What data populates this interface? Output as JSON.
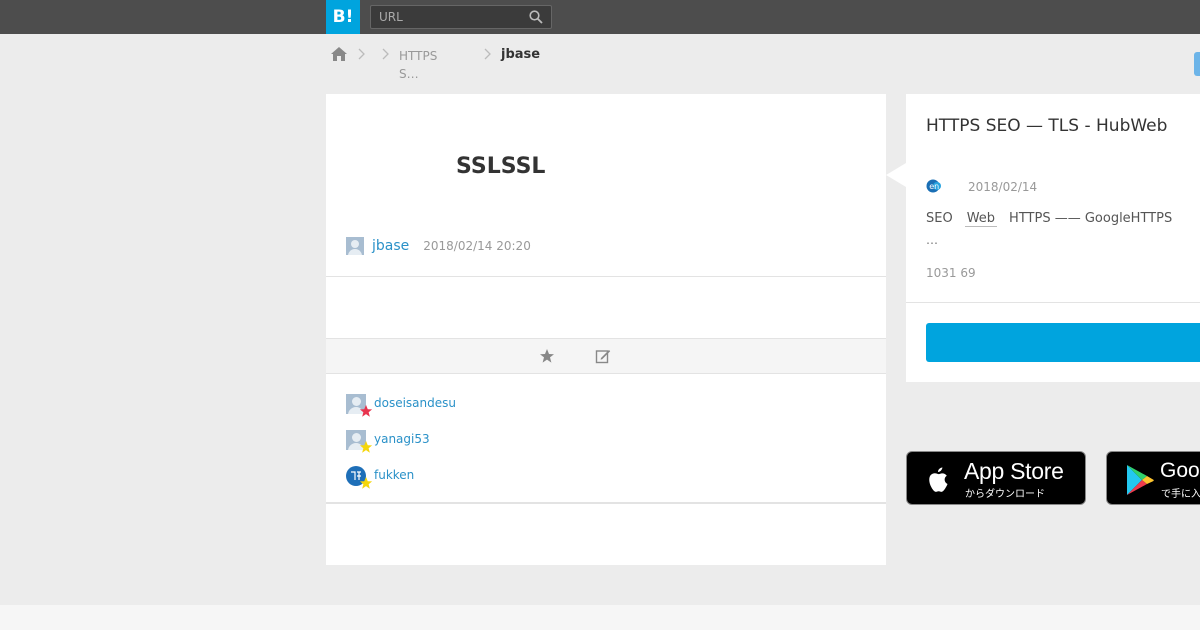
{
  "header": {
    "logo_text": "B!",
    "search_placeholder": "URL"
  },
  "breadcrumb": {
    "middle": "HTTPS S…",
    "user": "jbase"
  },
  "bookmark": {
    "comment": "SSLSSL",
    "user": "jbase",
    "date": "2018/02/14 20:20"
  },
  "stars": [
    {
      "user": "doseisandesu",
      "star_color": "#e8344e"
    },
    {
      "user": "yanagi53",
      "star_color": "#f5d60a"
    },
    {
      "user": "fukken",
      "star_color": "#f5d60a"
    }
  ],
  "entry": {
    "title": "HTTPS SEO — TLS - HubWeb",
    "date": "2018/02/14",
    "desc_1": "SEO",
    "desc_link": "Web",
    "desc_2": "HTTPS ——  GoogleHTTPS",
    "ellipsis": "…",
    "counts": "1031 69"
  },
  "apps": {
    "appstore_title": "App Store",
    "appstore_sub": "からダウンロード",
    "gplay_title": "Google Play",
    "gplay_sub": "で手に入れよう"
  },
  "colors": {
    "brand": "#00a4de",
    "link": "#2a91c8"
  }
}
